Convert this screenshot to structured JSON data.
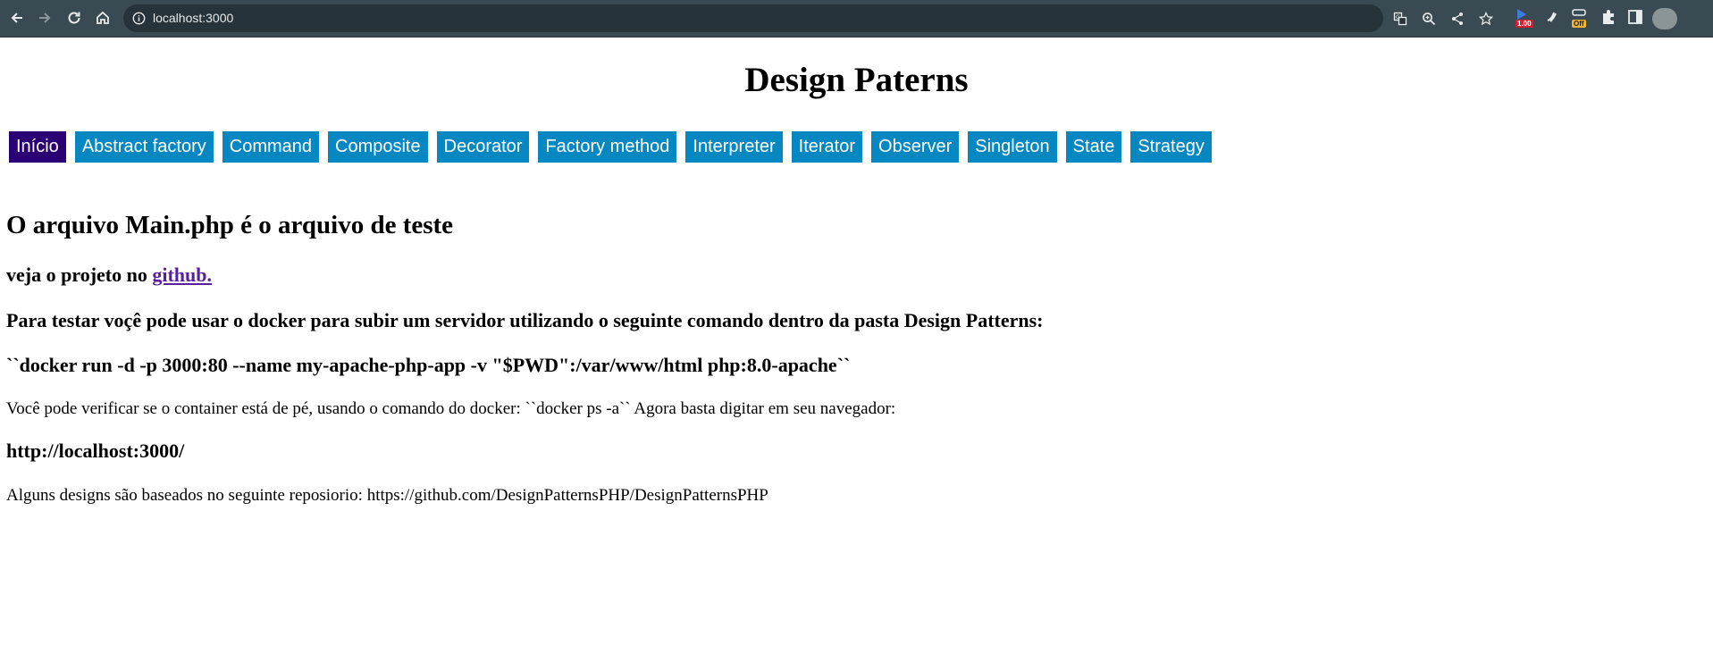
{
  "browser": {
    "url": "localhost:3000",
    "extension_badge": "1.00",
    "extension_off_label": "Off"
  },
  "page": {
    "title": "Design Paterns",
    "menu": [
      {
        "label": "Início",
        "active": true
      },
      {
        "label": "Abstract factory"
      },
      {
        "label": "Command"
      },
      {
        "label": "Composite"
      },
      {
        "label": "Decorator"
      },
      {
        "label": "Factory method"
      },
      {
        "label": "Interpreter"
      },
      {
        "label": "Iterator"
      },
      {
        "label": "Observer"
      },
      {
        "label": "Singleton"
      },
      {
        "label": "State"
      },
      {
        "label": "Strategy"
      }
    ],
    "heading": "O arquivo Main.php é o arquivo de teste",
    "project_prefix": "veja o projeto no ",
    "project_link": "github.",
    "test_instruction": "Para testar voçê pode usar o docker para subir um servidor utilizando o seguinte comando dentro da pasta Design Patterns:",
    "docker_command": "``docker run -d -p 3000:80 --name my-apache-php-app -v \"$PWD\":/var/www/html php:8.0-apache``",
    "verify_text": "Você pode verificar se o container está de pé, usando o comando do docker: ``docker ps -a`` Agora basta digitar em seu navegador:",
    "local_url": "http://localhost:3000/",
    "repo_text": "Alguns designs são baseados no seguinte reposiorio: https://github.com/DesignPatternsPHP/DesignPatternsPHP"
  },
  "colors": {
    "menu_bg": "#0587c1",
    "menu_active_bg": "#2a0074",
    "link": "#5a1ea0",
    "chrome_bg": "#3a4a52"
  }
}
